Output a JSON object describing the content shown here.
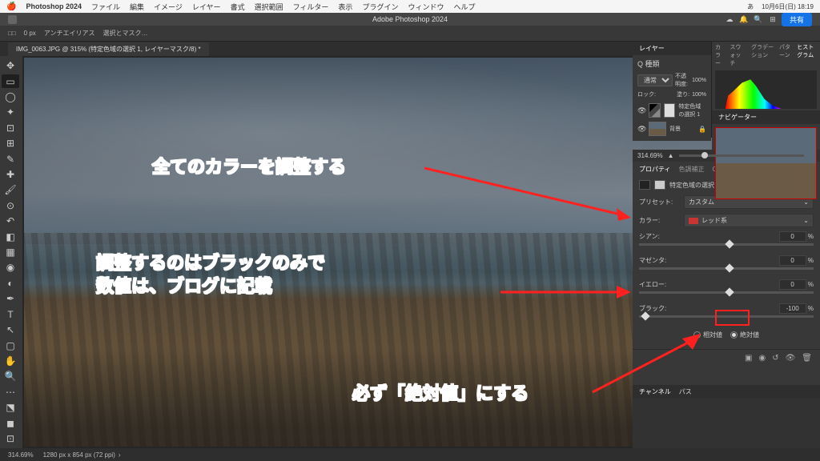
{
  "menubar": {
    "app_name": "Photoshop 2024",
    "items": [
      "ファイル",
      "編集",
      "イメージ",
      "レイヤー",
      "書式",
      "選択範囲",
      "フィルター",
      "表示",
      "プラグイン",
      "ウィンドウ",
      "ヘルプ"
    ],
    "right_items": [
      "あ",
      "10月6日(日) 18:19"
    ]
  },
  "topbar": {
    "share_label": "共有"
  },
  "optionsbar": {
    "items": [
      "□□",
      "0 px",
      "アンチエイリアス",
      "選択とマスク…"
    ]
  },
  "tab": {
    "title": "IMG_0063.JPG @ 315% (特定色域の選択 1, レイヤーマスク/8) *"
  },
  "window_title": "Adobe Photoshop 2024",
  "layers_panel": {
    "tab": "レイヤー",
    "search_label": "Q 種類",
    "blend_mode": "通常",
    "opacity_label": "不透明度:",
    "opacity_value": "100%",
    "lock_label": "ロック:",
    "fill_label": "塗り:",
    "fill_value": "100%",
    "layers": [
      {
        "name": "特定色域の選択 1"
      },
      {
        "name": "背景"
      }
    ]
  },
  "color_panel": {
    "tabs": [
      "カラー",
      "スウォッチ",
      "グラデーション",
      "パターン",
      "ヒストグラム"
    ],
    "active_tab": "ヒストグラム"
  },
  "navigator_panel": {
    "tab": "ナビゲーター",
    "zoom": "314.69%"
  },
  "properties_panel": {
    "tabs": [
      "プロパティ",
      "色調補正",
      "CC ライブラリ"
    ],
    "active_tab": "プロパティ",
    "adjustment_title": "特定色域の選択",
    "preset_label": "プリセット:",
    "preset_value": "カスタム",
    "color_label": "カラー:",
    "color_value": "レッド系",
    "sliders": [
      {
        "label": "シアン:",
        "value": "0",
        "unit": "%",
        "pos": 50
      },
      {
        "label": "マゼンタ:",
        "value": "0",
        "unit": "%",
        "pos": 50
      },
      {
        "label": "イエロー:",
        "value": "0",
        "unit": "%",
        "pos": 50
      },
      {
        "label": "ブラック:",
        "value": "-100",
        "unit": "%",
        "pos": 2
      }
    ],
    "method_relative": "相対値",
    "method_absolute": "絶対値"
  },
  "channels_panel": {
    "tabs": [
      "チャンネル",
      "パス"
    ]
  },
  "statusbar": {
    "zoom": "314.69%",
    "info": "1280 px x 854 px (72 ppi)"
  },
  "callouts": {
    "c1": "全てのカラーを調整する",
    "c2_line1": "調整するのはブラックのみで",
    "c2_line2": "数値は、ブログに記載",
    "c3": "必ず「絶対値」にする"
  }
}
